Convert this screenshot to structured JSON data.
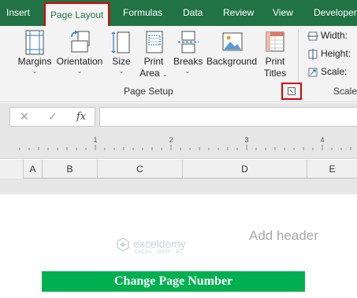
{
  "tabs": [
    {
      "label": "Insert",
      "active": false
    },
    {
      "label": "Page Layout",
      "active": true
    },
    {
      "label": "Formulas",
      "active": false
    },
    {
      "label": "Data",
      "active": false
    },
    {
      "label": "Review",
      "active": false
    },
    {
      "label": "View",
      "active": false
    },
    {
      "label": "Developer",
      "active": false
    }
  ],
  "page_setup": {
    "margins": "Margins",
    "orientation": "Orientation",
    "size": "Size",
    "print_area_line1": "Print",
    "print_area_line2": "Area",
    "breaks": "Breaks",
    "background": "Background",
    "print_titles_line1": "Print",
    "print_titles_line2": "Titles",
    "group_label": "Page Setup"
  },
  "scale_to_fit": {
    "width": "Width:",
    "height": "Height:",
    "scale": "Scale:",
    "group_label": "Scale t"
  },
  "formula_bar": {
    "cancel": "✕",
    "enter": "✓",
    "fx": "fx",
    "value": ""
  },
  "ruler": {
    "marks": [
      "1",
      "2",
      "3",
      "4"
    ]
  },
  "columns": [
    "A",
    "B",
    "C",
    "D",
    "E"
  ],
  "sheet": {
    "add_header": "Add header",
    "watermark": "exceldemy",
    "watermark_sub": "EXCEL · DATA · BI",
    "banner": "Change Page Number"
  },
  "colors": {
    "ribbon_green": "#217346",
    "highlight_red": "#e00000",
    "banner_green": "#00b050"
  }
}
